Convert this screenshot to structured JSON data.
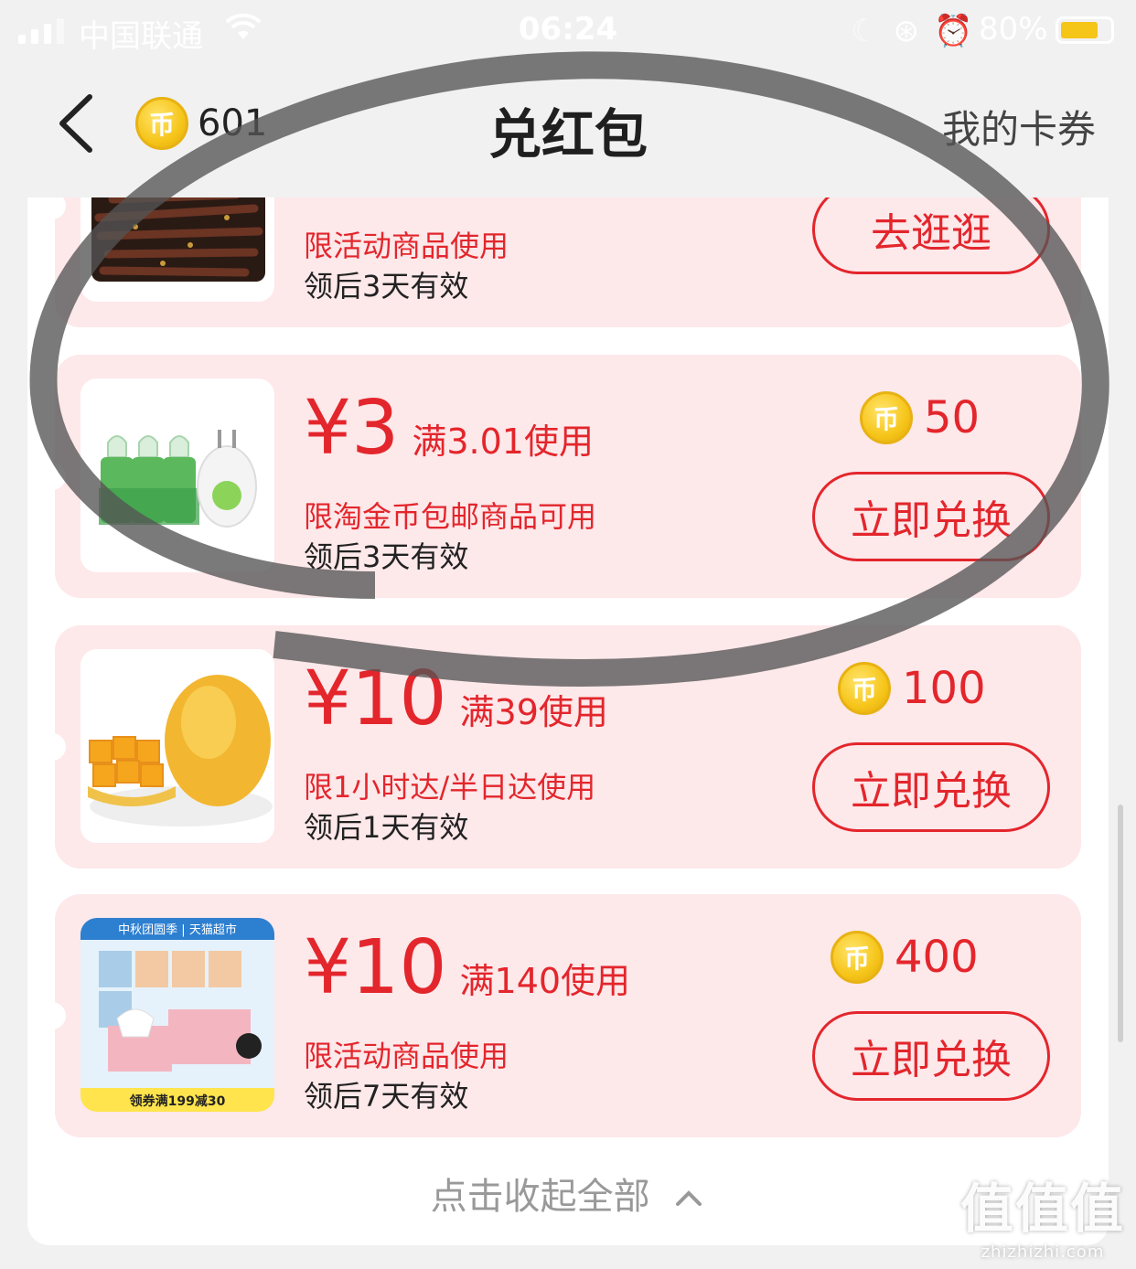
{
  "status_bar": {
    "carrier": "中国联通",
    "time": "06:24",
    "battery_percent": "80%",
    "battery_level": 0.8
  },
  "header": {
    "coin_balance": "601",
    "title": "兑红包",
    "my_coupons_label": "我的卡券"
  },
  "coupons": [
    {
      "amount": "",
      "threshold": "",
      "restriction": "限活动商品使用",
      "validity": "领后3天有效",
      "price": "",
      "button_label": "去逛逛",
      "thumb": "dried-meat"
    },
    {
      "amount": "¥3",
      "threshold": "满3.01使用",
      "restriction": "限淘金币包邮商品可用",
      "validity": "领后3天有效",
      "price": "50",
      "button_label": "立即兑换",
      "thumb": "mosquito-repellent"
    },
    {
      "amount": "¥10",
      "threshold": "满39使用",
      "restriction": "限1小时达/半日达使用",
      "validity": "领后1天有效",
      "price": "100",
      "button_label": "立即兑换",
      "thumb": "mango"
    },
    {
      "amount": "¥10",
      "threshold": "满140使用",
      "restriction": "限活动商品使用",
      "validity": "领后7天有效",
      "price": "400",
      "button_label": "立即兑换",
      "thumb": "tissue-pack",
      "thumb_banner": "中秋团圆季 | 天猫超市",
      "thumb_footer": "领券满199减30"
    }
  ],
  "collapse_label": "点击收起全部",
  "watermark": {
    "main": "值值值",
    "site": "zhizhizhi.com"
  },
  "colors": {
    "accent": "#e3262c",
    "card_bg": "#fde8ea",
    "coin": "#f6c51a"
  }
}
